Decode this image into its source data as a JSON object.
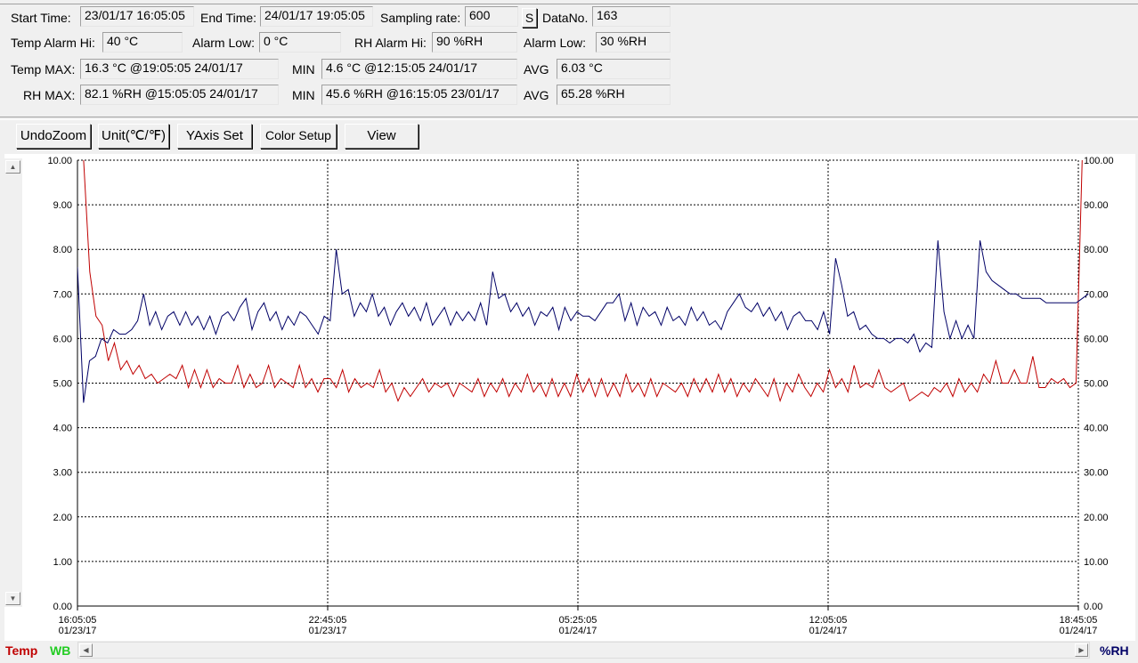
{
  "info": {
    "start_time_label": "Start Time:",
    "start_time": "23/01/17 16:05:05",
    "end_time_label": "End Time:",
    "end_time": "24/01/17 19:05:05",
    "sampling_rate_label": "Sampling rate:",
    "sampling_rate": "600",
    "s_button": "S",
    "data_no_label": "DataNo.",
    "data_no": "163",
    "temp_alarm_hi_label": "Temp Alarm Hi:",
    "temp_alarm_hi": "40 °C",
    "alarm_low_label": "Alarm Low:",
    "alarm_low": "0 °C",
    "rh_alarm_hi_label": "RH Alarm Hi:",
    "rh_alarm_hi": "90 %RH",
    "rh_alarm_low_label": "Alarm Low:",
    "rh_alarm_low": "30 %RH",
    "temp_max_label": "Temp MAX:",
    "temp_max": "16.3 °C @19:05:05 24/01/17",
    "temp_min_label": "MIN",
    "temp_min": "4.6 °C @12:15:05 24/01/17",
    "temp_avg_label": "AVG",
    "temp_avg": "6.03 °C",
    "rh_max_label": "RH MAX:",
    "rh_max": "82.1 %RH @15:05:05 24/01/17",
    "rh_min_label": "MIN",
    "rh_min": "45.6 %RH @16:15:05 23/01/17",
    "rh_avg_label": "AVG",
    "rh_avg": "65.28 %RH"
  },
  "toolbar": {
    "undo_zoom": "UndoZoom",
    "unit": "Unit(℃/℉)",
    "yaxis_set": "YAxis Set",
    "color_setup": "Color Setup",
    "view": "View"
  },
  "legend": {
    "temp": "Temp",
    "wb": "WB",
    "rh": "%RH"
  },
  "colors": {
    "temp": "#c00000",
    "rh": "#000066",
    "wb": "#22cc22"
  },
  "chart_data": {
    "type": "line",
    "left_ylim": [
      0,
      10
    ],
    "right_ylim": [
      0,
      100
    ],
    "left_ticks": [
      "0.00",
      "1.00",
      "2.00",
      "3.00",
      "4.00",
      "5.00",
      "6.00",
      "7.00",
      "8.00",
      "9.00",
      "10.00"
    ],
    "right_ticks": [
      "0.00",
      "10.00",
      "20.00",
      "30.00",
      "40.00",
      "50.00",
      "60.00",
      "70.00",
      "80.00",
      "90.00",
      "100.00"
    ],
    "x_ticks": [
      {
        "time": "16:05:05",
        "date": "01/23/17"
      },
      {
        "time": "22:45:05",
        "date": "01/23/17"
      },
      {
        "time": "05:25:05",
        "date": "01/24/17"
      },
      {
        "time": "12:05:05",
        "date": "01/24/17"
      },
      {
        "time": "18:45:05",
        "date": "01/24/17"
      }
    ],
    "grid": true,
    "series": [
      {
        "name": "Temp",
        "axis": "left",
        "values": [
          16.3,
          10.0,
          7.5,
          6.5,
          6.3,
          5.5,
          5.9,
          5.3,
          5.5,
          5.2,
          5.4,
          5.1,
          5.2,
          5.0,
          5.1,
          5.2,
          5.1,
          5.4,
          4.9,
          5.3,
          4.9,
          5.3,
          4.9,
          5.1,
          5.0,
          5.0,
          5.4,
          4.9,
          5.2,
          4.9,
          5.0,
          5.4,
          4.9,
          5.1,
          5.0,
          4.9,
          5.4,
          4.9,
          5.1,
          4.8,
          5.1,
          5.1,
          4.9,
          5.3,
          4.8,
          5.1,
          4.9,
          5.0,
          4.9,
          5.3,
          4.8,
          5.0,
          4.6,
          4.9,
          4.7,
          4.9,
          5.1,
          4.8,
          5.0,
          4.9,
          5.0,
          4.7,
          5.0,
          4.9,
          4.8,
          5.1,
          4.7,
          5.0,
          4.8,
          5.1,
          4.7,
          5.0,
          4.8,
          5.2,
          4.8,
          5.0,
          4.7,
          5.1,
          4.7,
          5.0,
          4.7,
          5.2,
          4.8,
          5.1,
          4.7,
          5.1,
          4.7,
          5.0,
          4.7,
          5.2,
          4.8,
          5.0,
          4.7,
          5.1,
          4.7,
          5.0,
          4.9,
          4.8,
          5.0,
          4.7,
          5.1,
          4.8,
          5.1,
          4.8,
          5.2,
          4.8,
          5.1,
          4.7,
          5.0,
          4.8,
          5.1,
          4.9,
          4.7,
          5.1,
          4.6,
          5.0,
          4.8,
          5.2,
          4.9,
          4.7,
          5.0,
          4.8,
          5.3,
          4.9,
          5.1,
          4.8,
          5.4,
          4.9,
          5.0,
          4.9,
          5.3,
          4.9,
          4.8,
          4.9,
          5.0,
          4.6,
          4.7,
          4.8,
          4.7,
          4.9,
          4.8,
          5.0,
          4.7,
          5.1,
          4.8,
          5.0,
          4.8,
          5.2,
          5.0,
          5.5,
          5.0,
          5.0,
          5.3,
          5.0,
          5.0,
          5.6,
          4.9,
          4.9,
          5.1,
          5.0,
          5.1,
          4.9,
          5.0,
          10.0,
          16.3
        ],
        "color": "#c00000"
      },
      {
        "name": "%RH",
        "axis": "right",
        "values": [
          76,
          45.6,
          55,
          56,
          60,
          59,
          62,
          61,
          61,
          62,
          64,
          70,
          63,
          66,
          62,
          65,
          66,
          63,
          66,
          63,
          65,
          62,
          65,
          61,
          65,
          66,
          64,
          67,
          69,
          62,
          66,
          68,
          64,
          66,
          62,
          65,
          63,
          66,
          65,
          63,
          61,
          65,
          64,
          80,
          70,
          71,
          65,
          68,
          66,
          70,
          65,
          67,
          63,
          66,
          68,
          65,
          67,
          64,
          68,
          63,
          65,
          67,
          63,
          66,
          64,
          66,
          64,
          68,
          63,
          75,
          69,
          70,
          66,
          68,
          65,
          67,
          63,
          66,
          65,
          67,
          62,
          67,
          64,
          66,
          65,
          65,
          64,
          66,
          68,
          68,
          70,
          64,
          68,
          63,
          67,
          65,
          66,
          63,
          67,
          64,
          65,
          63,
          67,
          64,
          66,
          63,
          64,
          62,
          66,
          68,
          70,
          67,
          66,
          68,
          65,
          67,
          64,
          66,
          62,
          65,
          66,
          64,
          64,
          62,
          66,
          61,
          78,
          72,
          65,
          66,
          62,
          63,
          61,
          60,
          60,
          59,
          60,
          60,
          59,
          61,
          57,
          59,
          58,
          82,
          66,
          60,
          64,
          60,
          63,
          60,
          82,
          75,
          73,
          72,
          71,
          70,
          70,
          69,
          69,
          69,
          69,
          68,
          68,
          68,
          68,
          68,
          68,
          69,
          70
        ],
        "color": "#000066"
      }
    ]
  }
}
